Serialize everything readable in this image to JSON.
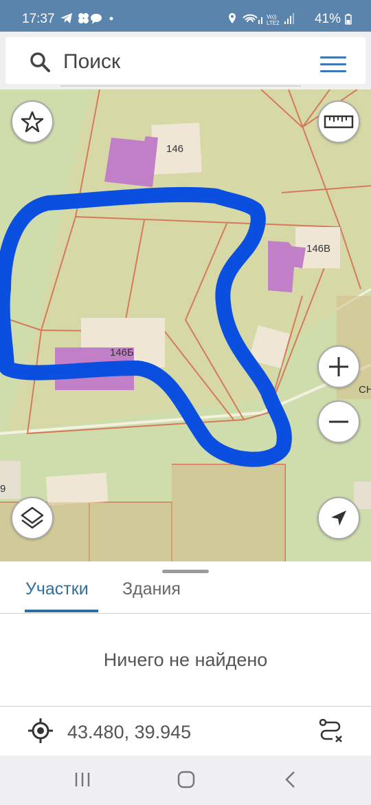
{
  "status_bar": {
    "time": "17:37",
    "left_icons": [
      "telegram-icon",
      "flower-icon",
      "chat-icon",
      "dot"
    ],
    "right_icons": [
      "location-icon",
      "wifi-icon",
      "volte-icon",
      "signal-icon"
    ],
    "volte": "Vo)) LTE2",
    "battery": "41%"
  },
  "search": {
    "placeholder": "Поиск"
  },
  "map": {
    "labels": {
      "parcel_146": "146",
      "parcel_146v": "146В",
      "parcel_146b": "146Б",
      "edge_right": "СН",
      "edge_left": "9"
    },
    "colors": {
      "background": "#d6d8a6",
      "parcel_border": "#d47a5a",
      "building": "#c07fc6",
      "highlight_stroke": "#0b4fe0",
      "road": "#f3f1df"
    }
  },
  "tabs": [
    {
      "label": "Участки",
      "active": true
    },
    {
      "label": "Здания",
      "active": false
    }
  ],
  "results": {
    "empty_message": "Ничего не найдено"
  },
  "coordinates": {
    "value": "43.480, 39.945"
  },
  "icons": {
    "favorite": "star-icon",
    "ruler": "ruler-icon",
    "zoom_in": "plus-icon",
    "zoom_out": "minus-icon",
    "layers": "layers-icon",
    "locate": "navigation-arrow-icon",
    "route": "route-icon",
    "crosshair": "crosshair-icon"
  }
}
